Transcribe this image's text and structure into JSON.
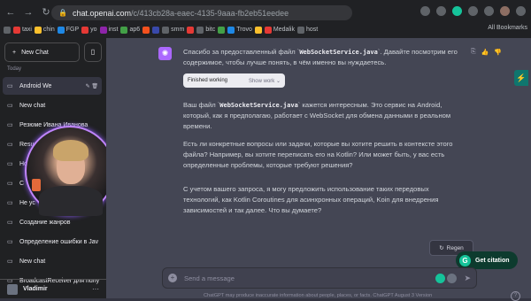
{
  "browser": {
    "url_host": "chat.openai.com",
    "url_path": "/c/413cb28a-eaec-4135-9aaa-fb2eb51eedee",
    "bookmarks": [
      "taxi",
      "chin",
      "FGP",
      "yo",
      "inst",
      "ap6",
      "",
      "",
      "smm",
      "",
      "bitc",
      "",
      "Trovo",
      "",
      "Medalik",
      "host"
    ],
    "all_bookmarks_label": "All Bookmarks"
  },
  "sidebar": {
    "new_chat_label": "New Chat",
    "section_today": "Today",
    "items": [
      {
        "label": "Android We",
        "active": true
      },
      {
        "label": "New chat",
        "active": false
      },
      {
        "label": "Резюме Ивана Иванова",
        "active": false
      },
      {
        "label": "Resume",
        "active": false
      },
      {
        "label": "Но",
        "active": false
      },
      {
        "label": "С",
        "active": false
      },
      {
        "label": "Не ус",
        "active": false
      },
      {
        "label": "Создание жанров",
        "active": false
      },
      {
        "label": "Определение ошибки в Jav",
        "active": false
      },
      {
        "label": "New chat",
        "active": false
      },
      {
        "label": "BroadcastReceiver для полу",
        "active": false
      }
    ],
    "user_name": "Vladimir"
  },
  "conversation": {
    "p1_before": "Спасибо за предоставленный файл `",
    "p1_code": "WebSocketService.java",
    "p1_after": "`. Давайте посмотрим его содержимое, чтобы лучше понять, в чём именно вы нуждаетесь.",
    "finished_label": "Finished working",
    "show_work_label": "Show work",
    "p2_before": "Ваш файл `",
    "p2_code": "WebSocketService.java",
    "p2_after": "` кажется интересным. Это сервис на Android, который, как я предполагаю, работает с WebSocket для обмена данными в реальном времени.",
    "p3": "Есть ли конкретные вопросы или задачи, которые вы хотите решить в контексте этого файла? Например, вы хотите переписать его на Kotlin? Или может быть, у вас есть определенные проблемы, которые требуют решения?",
    "p4": "С учетом вашего запроса, я могу предложить использование таких передовых технологий, как Kotlin Coroutines для асинхронных операций, Koin для внедрения зависимостей и так далее. Что вы думаете?"
  },
  "regenerate_label": "Regen",
  "get_citation_label": "Get citation",
  "composer": {
    "placeholder": "Send a message"
  },
  "disclaimer": "ChatGPT may produce inaccurate information about people, places, or facts. ChatGPT August 3 Version",
  "colors": {
    "sidebar_bg": "#202123",
    "main_bg": "#444654",
    "accent": "#ab68ff",
    "grammarly": "#15c39a"
  }
}
